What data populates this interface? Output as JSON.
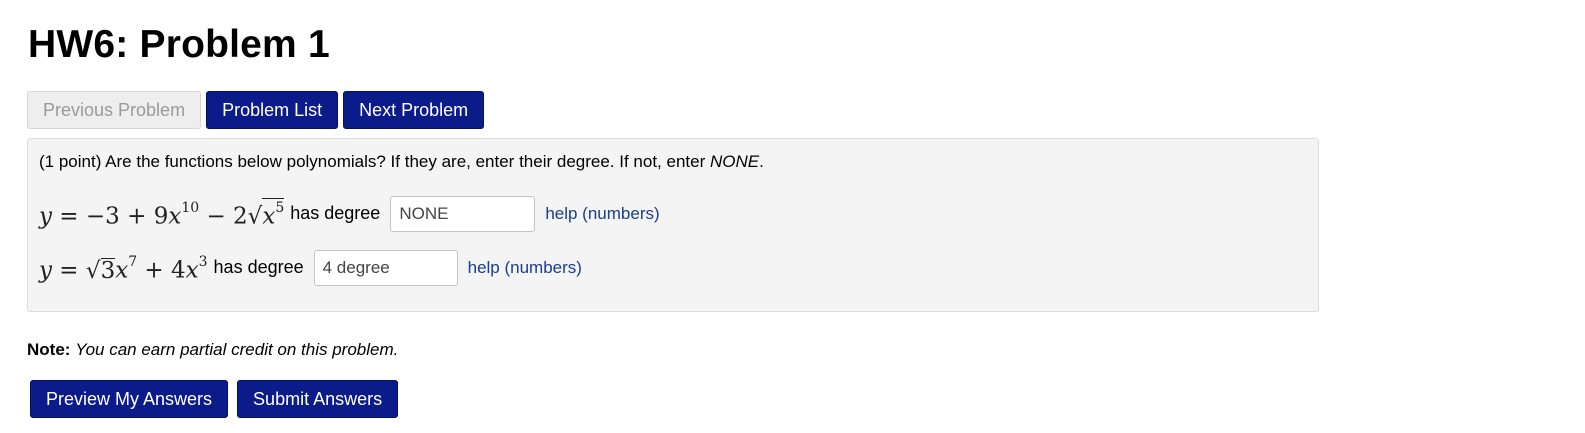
{
  "page": {
    "title": "HW6: Problem 1"
  },
  "nav": {
    "previous_label": "Previous Problem",
    "list_label": "Problem List",
    "next_label": "Next Problem"
  },
  "problem": {
    "points": "(1 point)",
    "instructions_pre": "Are the functions below polynomials? If they are, enter their degree. If not, enter ",
    "instructions_none": "NONE",
    "instructions_post": ".",
    "rows": [
      {
        "equation_text": "y = −3 + 9x^10 − 2√(x^5)",
        "has_degree_label": "has degree",
        "answer_value": "NONE",
        "help_label": "help (numbers)"
      },
      {
        "equation_text": "y = √3 x^7 + 4x^3",
        "has_degree_label": "has degree",
        "answer_value": "4 degree",
        "help_label": "help (numbers)"
      }
    ]
  },
  "note": {
    "label": "Note:",
    "text": "You can earn partial credit on this problem."
  },
  "actions": {
    "preview_label": "Preview My Answers",
    "submit_label": "Submit Answers"
  },
  "colors": {
    "primary_button": "#0b1b8a",
    "disabled_button": "#eeeeee",
    "link": "#1a3e8c",
    "problem_background": "#f4f4f4"
  }
}
